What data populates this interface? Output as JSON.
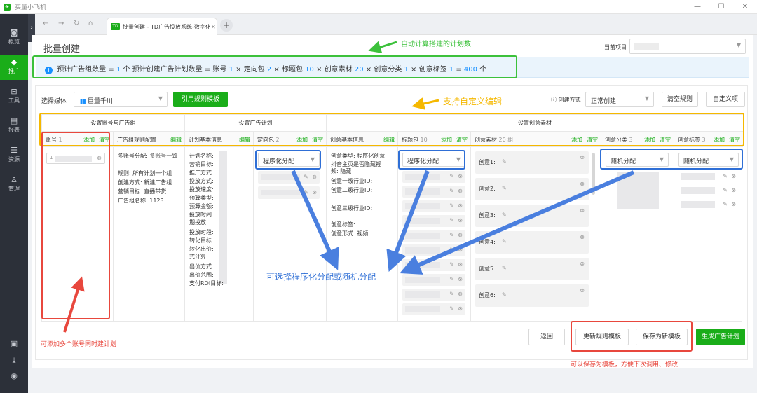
{
  "window": {
    "title": "买量小飞机",
    "min": "—",
    "max": "☐",
    "close": "✕"
  },
  "sidebar": {
    "items": [
      {
        "icon": "◙",
        "label": "概览"
      },
      {
        "icon": "◆",
        "label": "推广"
      },
      {
        "icon": "⊟",
        "label": "工具"
      },
      {
        "icon": "▤",
        "label": "报表"
      },
      {
        "icon": "☰",
        "label": "资源"
      },
      {
        "icon": "♙",
        "label": "管理"
      }
    ],
    "bottom_icons": [
      "▣",
      "⤓",
      "◉"
    ],
    "active": "推广"
  },
  "browser": {
    "back": "←",
    "forward": "→",
    "reload": "↻",
    "home": "⌂",
    "tab_favicon": "TD",
    "tab_title": "批量创建 - TD广告投放系统-数字化",
    "tab_close": "✕",
    "new_tab": "+"
  },
  "header": {
    "title": "批量创建",
    "project_label": "当前项目"
  },
  "info": {
    "parts": [
      {
        "t": "预计广告组数量 = ",
        "n": false
      },
      {
        "t": "1",
        "n": true
      },
      {
        "t": " 个    预计创建广告计划数量 = 账号 ",
        "n": false
      },
      {
        "t": "1",
        "n": true
      },
      {
        "t": " × 定向包 ",
        "n": false
      },
      {
        "t": "2",
        "n": true
      },
      {
        "t": " × 标题包 ",
        "n": false
      },
      {
        "t": "10",
        "n": true
      },
      {
        "t": " × 创意素材 ",
        "n": false
      },
      {
        "t": "20",
        "n": true
      },
      {
        "t": " × 创意分类 ",
        "n": false
      },
      {
        "t": "1",
        "n": true
      },
      {
        "t": " × 创意标签 ",
        "n": false
      },
      {
        "t": "1",
        "n": true
      },
      {
        "t": " = ",
        "n": false
      },
      {
        "t": "400",
        "n": true
      },
      {
        "t": " 个",
        "n": false
      }
    ]
  },
  "toolbar": {
    "media_label": "选择媒体",
    "media_value": "巨量千川",
    "apply_template": "引用规则模板",
    "create_mode_label": "创建方式",
    "create_mode_value": "正常创建",
    "clear_rules": "清空规则",
    "custom_items": "自定义项"
  },
  "groups": {
    "account": "设置账号与广告组",
    "plan": "设置广告计划",
    "creative": "设置创意素材"
  },
  "columns": {
    "account": {
      "title": "账号",
      "count": "1",
      "add": "添加",
      "clear": "清空",
      "item_prefix": "1"
    },
    "adgroup_rule": {
      "title": "广告组规则配置",
      "edit": "编辑"
    },
    "plan_basic": {
      "title": "计划基本信息",
      "edit": "编辑"
    },
    "targeting": {
      "title": "定向包",
      "count": "2",
      "add": "添加",
      "clear": "清空",
      "select": "程序化分配"
    },
    "creative_basic": {
      "title": "创意基本信息",
      "edit": "编辑"
    },
    "title_pack": {
      "title": "标题包",
      "count": "10",
      "add": "添加",
      "clear": "清空",
      "select": "程序化分配"
    },
    "creative_material": {
      "title": "创意素材",
      "count": "20 组",
      "add": "添加",
      "clear": "清空"
    },
    "creative_category": {
      "title": "创意分类",
      "count": "3",
      "add": "添加",
      "clear": "清空",
      "select": "随机分配"
    },
    "creative_tag": {
      "title": "创意标签",
      "count": "3",
      "add": "添加",
      "clear": "清空",
      "select": "随机分配"
    }
  },
  "adgroup_rule": {
    "multi_account_label": "多账号分配:",
    "multi_account_value": "多账号一致",
    "rule": "规则: 所有计划一个组",
    "create_method": "创建方式: 新建广告组",
    "marketing_goal": "营销目标: 直播带货",
    "group_name": "广告组名称: 1123"
  },
  "plan_fields": [
    "计划名称:",
    "营销目标:",
    "推广方式:",
    "投放方式:",
    "投放速度:",
    "预算类型:",
    "预算金额:",
    "投放时间:",
    "期投放",
    "投放时段:",
    "转化目标:",
    "转化出价:",
    "式计算",
    "出价方式:",
    "出价范围:",
    "支付ROI目标:"
  ],
  "creative_fields": {
    "type": "创意类型: 程序化创意",
    "douyin": "抖音主页是否隐藏视",
    "douyin2": "频: 隐藏",
    "industry1": "创意一级行业ID:",
    "industry2": "创意二级行业ID:",
    "industry3": "创意三级行业ID:",
    "tag": "创意标签:",
    "form": "创意形式: 视频"
  },
  "materials": [
    "创意1:",
    "创意2:",
    "创意3:",
    "创意4:",
    "创意5:",
    "创意6:"
  ],
  "footer": {
    "back": "返回",
    "update_template": "更新规则模板",
    "save_template": "保存为新模板",
    "generate": "生成广告计划"
  },
  "annotations": {
    "auto_count": "自动计算搭建的计划数",
    "custom_edit": "支持自定义编辑",
    "allocation": "可选择程序化分配或随机分配",
    "multi_account": "可添加多个账号同时建计划",
    "save_template": "可以保存为模板，方便下次调用、修改"
  },
  "colors": {
    "brand": "#1aad19",
    "link": "#1890ff",
    "ann_green": "#3cc13b",
    "ann_yellow": "#f5b800",
    "ann_blue": "#2f6fd6",
    "ann_red": "#e8473d"
  }
}
